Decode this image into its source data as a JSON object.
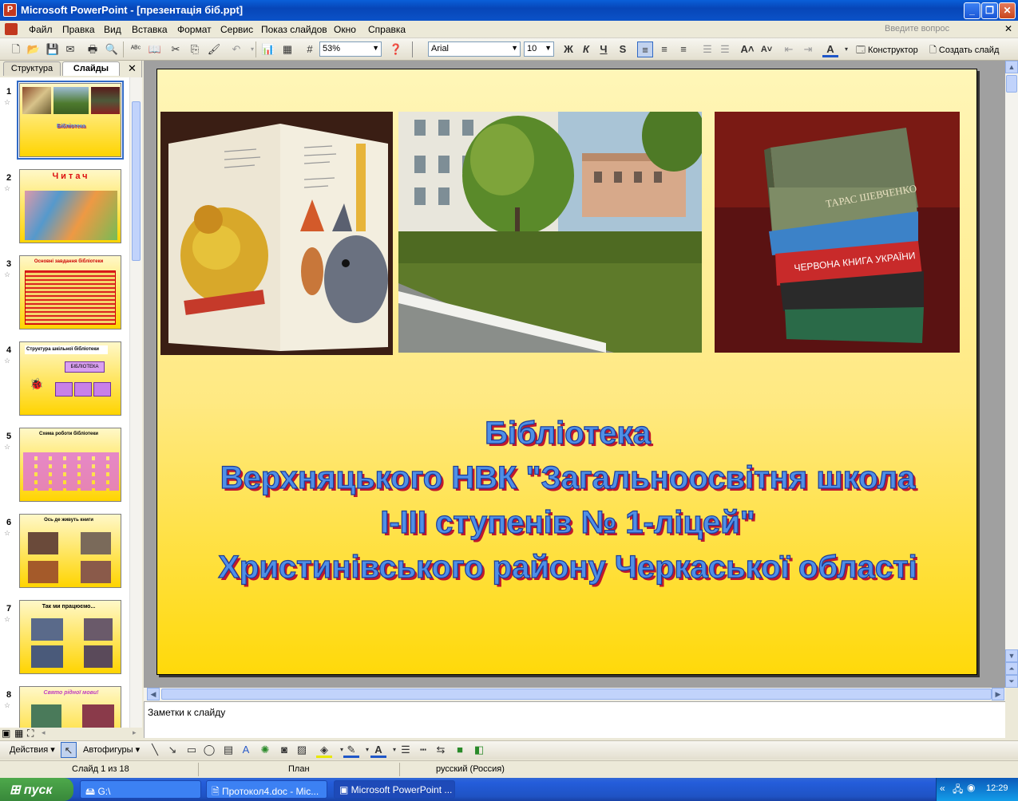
{
  "window": {
    "title": "Microsoft PowerPoint - [презентація біб.ppt]",
    "app_icon": "powerpoint-icon",
    "controls": [
      "minimize",
      "restore",
      "close"
    ]
  },
  "menu": {
    "items": [
      "Файл",
      "Правка",
      "Вид",
      "Вставка",
      "Формат",
      "Сервис",
      "Показ слайдов",
      "Окно",
      "Справка"
    ],
    "ask_placeholder": "Введите вопрос"
  },
  "toolbar": {
    "zoom": "53%",
    "font_name": "Arial",
    "font_size": "10",
    "bold": "Ж",
    "italic": "К",
    "underline": "Ч",
    "shadow": "S",
    "designer_label": "Конструктор",
    "new_slide_label": "Создать слайд"
  },
  "left_pane": {
    "tabs": [
      "Структура",
      "Слайды"
    ],
    "selected_tab": "Слайды",
    "slides": [
      {
        "num": "1",
        "title": "Бібліотека"
      },
      {
        "num": "2",
        "title": "Читач"
      },
      {
        "num": "3",
        "title": "Основні завдання бібліотеки"
      },
      {
        "num": "4",
        "title": "Структура шкільної бібліотеки"
      },
      {
        "num": "5",
        "title": "Схема роботи бібліотеки"
      },
      {
        "num": "6",
        "title": "Ось де живуть книги"
      },
      {
        "num": "7",
        "title": "Так ми працюємо..."
      },
      {
        "num": "8",
        "title": "Свято рідної мови!"
      }
    ],
    "thumb4_box": "БІБЛІОТЕКА"
  },
  "slide": {
    "title_lines": [
      "Бібліотека",
      "Верхняцького НВК \"Загальноосвітня школа",
      "І-ІІІ ступенів № 1-ліцей\"",
      "Христинівського району Черкаської області"
    ],
    "photos": [
      "open-book-photo",
      "school-building-photo",
      "books-stack-photo"
    ]
  },
  "notes": {
    "placeholder": "Заметки к слайду"
  },
  "draw_toolbar": {
    "actions_label": "Действия",
    "autoshapes_label": "Автофигуры"
  },
  "status": {
    "slide_info": "Слайд 1 из 18",
    "design": "План",
    "language": "русский (Россия)"
  },
  "taskbar": {
    "start_label": "пуск",
    "tasks": [
      "G:\\",
      "Протокол4.doc - Mic...",
      "Microsoft PowerPoint ..."
    ],
    "clock": "12:29"
  },
  "colors": {
    "slide_title_fill": "#4F8FE6",
    "slide_title_shadow": "#C0182D",
    "slide_bg_top": "#FFF6B8",
    "slide_bg_bottom": "#FFD90A",
    "taskbar": "#245DDB"
  }
}
